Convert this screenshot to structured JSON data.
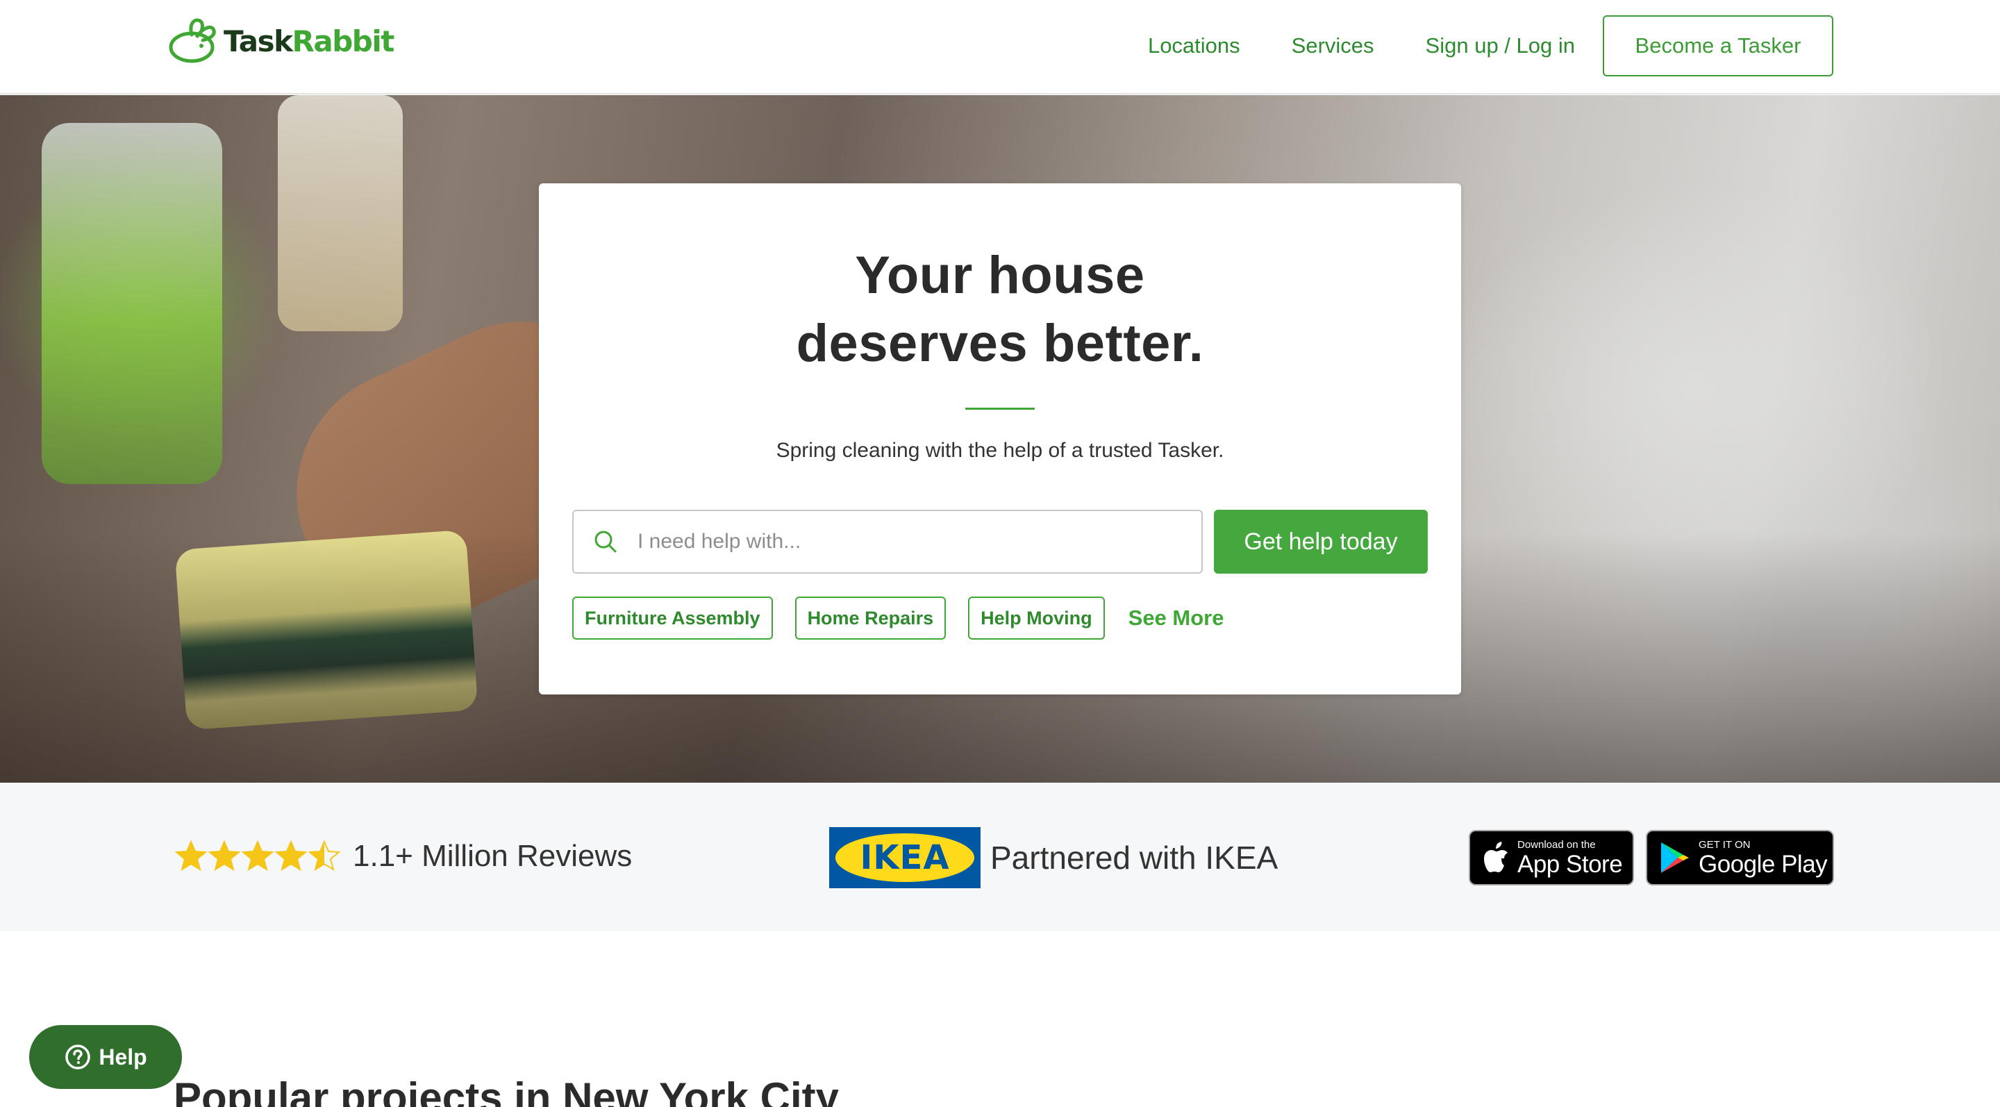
{
  "brand": {
    "logo_part1": "Task",
    "logo_part2": "Rabbit",
    "colors": {
      "primary_green": "#45a83f",
      "dark_green": "#2f6e2b",
      "link_green": "#2c8a2f",
      "star_yellow": "#f5c518",
      "ikea_blue": "#0058a3",
      "ikea_yellow": "#ffda1a"
    }
  },
  "nav": {
    "locations": "Locations",
    "services": "Services",
    "signup_login": "Sign up / Log in",
    "become_tasker": "Become a Tasker"
  },
  "hero": {
    "title_line1": "Your house",
    "title_line2": "deserves better.",
    "subtitle": "Spring cleaning with the help of a trusted Tasker.",
    "search": {
      "placeholder": "I need help with...",
      "value": "",
      "icon": "search-icon"
    },
    "cta": "Get help today",
    "chips": [
      "Furniture Assembly",
      "Home Repairs",
      "Help Moving"
    ],
    "see_more": "See More"
  },
  "trust": {
    "rating_stars": 4.5,
    "rating_max": 5,
    "reviews_text": "1.1+ Million Reviews",
    "partner_logo_text": "IKEA",
    "partner_text": "Partnered with IKEA",
    "app_store": {
      "small": "Download on the",
      "big": "App Store",
      "icon": "apple-icon"
    },
    "google_play": {
      "small": "GET IT ON",
      "big": "Google Play",
      "icon": "google-play-icon"
    }
  },
  "popular": {
    "title": "Popular projects in New York City"
  },
  "help_widget": {
    "label": "Help",
    "icon": "question-circle-icon"
  }
}
